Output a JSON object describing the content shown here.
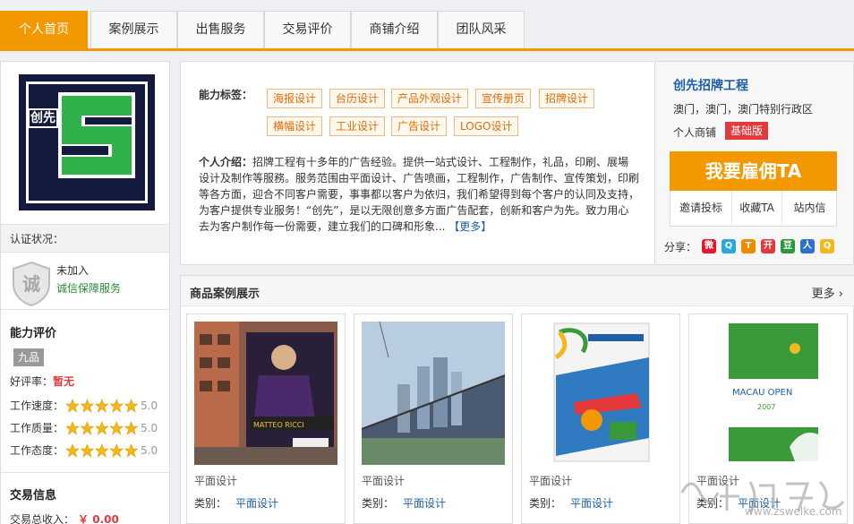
{
  "tabs": [
    {
      "label": "个人首页",
      "active": true
    },
    {
      "label": "案例展示",
      "active": false
    },
    {
      "label": "出售服务",
      "active": false
    },
    {
      "label": "交易评价",
      "active": false
    },
    {
      "label": "商铺介绍",
      "active": false
    },
    {
      "label": "团队风采",
      "active": false
    }
  ],
  "sidebar": {
    "logo_text": "创先",
    "auth_title": "认证状况：",
    "auth_status": "未加入",
    "auth_link": "诚信保障服务",
    "shield_char": "诚",
    "ability_title": "能力评价",
    "level_badge": "九品",
    "praise_label": "好评率：",
    "praise_value": "暂无",
    "ratings": [
      {
        "label": "工作速度：",
        "score": "5.0",
        "stars": 5
      },
      {
        "label": "工作质量：",
        "score": "5.0",
        "stars": 5
      },
      {
        "label": "工作态度：",
        "score": "5.0",
        "stars": 5
      }
    ],
    "trade_title": "交易信息",
    "trade_income_label": "交易总收入：",
    "trade_income_value": "￥ 0.00"
  },
  "profile": {
    "ability_label": "能力标签：",
    "tags": [
      "海报设计",
      "台历设计",
      "产品外观设计",
      "宣传册页",
      "招牌设计",
      "横幅设计",
      "工业设计",
      "广告设计",
      "LOGO设计"
    ],
    "intro_label": "个人介绍：",
    "intro_text": "招牌工程有十多年的广告经验。提供一站式设计、工程制作，礼品，印刷、展場设计及制作等服務。服务范围由平面设计、广告喷画，工程制作，广告制作、宣传策划，印刷等各方面，迎合不同客户需要，事事都以客户为依归，我们希望得到每个客户的认同及支持，为客户提供专业服务！“创先”，是以无限创意多方面广告配套，创新和客户为先。致力用心去为客户制作每一份需要，建立我们的口碑和形象...",
    "more_label": "【更多】"
  },
  "store": {
    "company": "创先招牌工程",
    "location": "澳门，澳门，澳门特别行政区",
    "store_type": "个人商铺",
    "level_badge": "基础版",
    "hire_button": "我要雇佣TA",
    "actions": [
      "邀请投标",
      "收藏TA",
      "站内信"
    ],
    "share_label": "分享：",
    "share_icons": [
      {
        "name": "weibo-icon",
        "color": "#e6162d",
        "glyph": "微"
      },
      {
        "name": "qzone-icon",
        "color": "#2aa7e0",
        "glyph": "Q"
      },
      {
        "name": "tencent-weibo-icon",
        "color": "#f08a00",
        "glyph": "T"
      },
      {
        "name": "kaixin-icon",
        "color": "#e4393c",
        "glyph": "开"
      },
      {
        "name": "douban-icon",
        "color": "#2e963d",
        "glyph": "豆"
      },
      {
        "name": "renren-icon",
        "color": "#2b72cc",
        "glyph": "人"
      },
      {
        "name": "qq-icon",
        "color": "#f3b81b",
        "glyph": "Q"
      }
    ]
  },
  "showcase": {
    "title": "商品案例展示",
    "more": "更多 ›",
    "items": [
      {
        "title": "平面设计",
        "cat_label": "类别：",
        "cat_value": "平面设计"
      },
      {
        "title": "平面设计",
        "cat_label": "类别：",
        "cat_value": "平面设计"
      },
      {
        "title": "平面设计",
        "cat_label": "类别：",
        "cat_value": "平面设计"
      },
      {
        "title": "平面设计",
        "cat_label": "类别：",
        "cat_value": "平面设计"
      }
    ]
  },
  "watermark": {
    "text": "www.zswelke.com"
  },
  "colors": {
    "accent": "#f39800",
    "link": "#1f5fa8",
    "alert": "#e4393c"
  }
}
